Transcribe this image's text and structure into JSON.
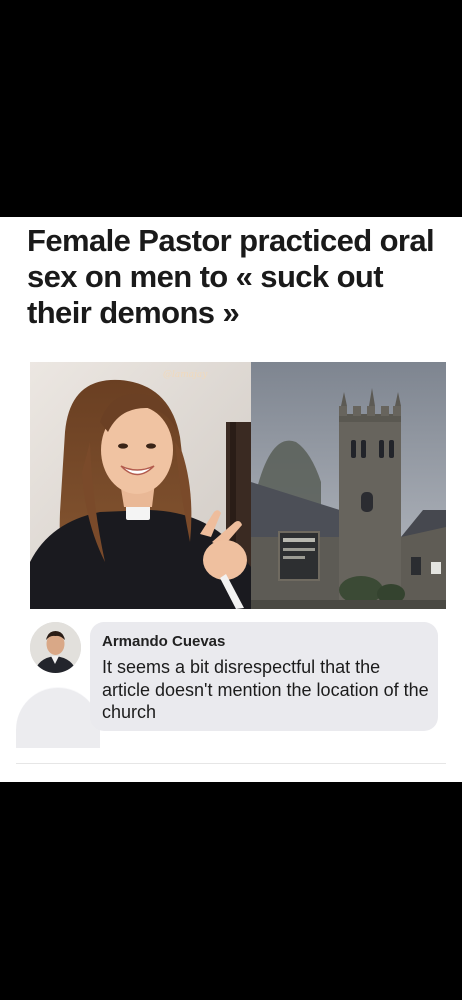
{
  "post": {
    "headline": "Female Pastor practiced oral sex on men to « suck out their demons »",
    "watermark": "@lamajay"
  },
  "comment": {
    "author": "Armando Cuevas",
    "text": "It seems a bit disrespectful that the article doesn't mention the location of the church"
  },
  "colors": {
    "background": "#000000",
    "card": "#ffffff",
    "comment_bubble": "#eaeaee",
    "headline_text": "#1a1a1a"
  }
}
